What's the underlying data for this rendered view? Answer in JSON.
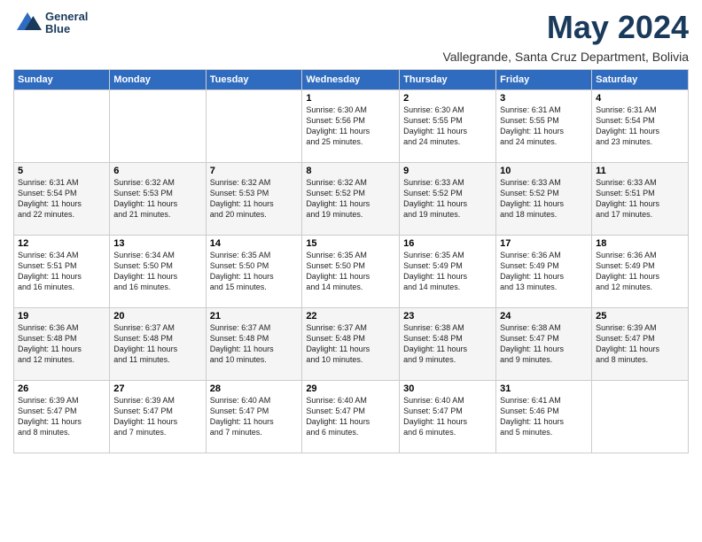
{
  "header": {
    "logo_line1": "General",
    "logo_line2": "Blue",
    "month_title": "May 2024",
    "subtitle": "Vallegrande, Santa Cruz Department, Bolivia"
  },
  "weekdays": [
    "Sunday",
    "Monday",
    "Tuesday",
    "Wednesday",
    "Thursday",
    "Friday",
    "Saturday"
  ],
  "weeks": [
    [
      {
        "day": "",
        "info": ""
      },
      {
        "day": "",
        "info": ""
      },
      {
        "day": "",
        "info": ""
      },
      {
        "day": "1",
        "info": "Sunrise: 6:30 AM\nSunset: 5:56 PM\nDaylight: 11 hours\nand 25 minutes."
      },
      {
        "day": "2",
        "info": "Sunrise: 6:30 AM\nSunset: 5:55 PM\nDaylight: 11 hours\nand 24 minutes."
      },
      {
        "day": "3",
        "info": "Sunrise: 6:31 AM\nSunset: 5:55 PM\nDaylight: 11 hours\nand 24 minutes."
      },
      {
        "day": "4",
        "info": "Sunrise: 6:31 AM\nSunset: 5:54 PM\nDaylight: 11 hours\nand 23 minutes."
      }
    ],
    [
      {
        "day": "5",
        "info": "Sunrise: 6:31 AM\nSunset: 5:54 PM\nDaylight: 11 hours\nand 22 minutes."
      },
      {
        "day": "6",
        "info": "Sunrise: 6:32 AM\nSunset: 5:53 PM\nDaylight: 11 hours\nand 21 minutes."
      },
      {
        "day": "7",
        "info": "Sunrise: 6:32 AM\nSunset: 5:53 PM\nDaylight: 11 hours\nand 20 minutes."
      },
      {
        "day": "8",
        "info": "Sunrise: 6:32 AM\nSunset: 5:52 PM\nDaylight: 11 hours\nand 19 minutes."
      },
      {
        "day": "9",
        "info": "Sunrise: 6:33 AM\nSunset: 5:52 PM\nDaylight: 11 hours\nand 19 minutes."
      },
      {
        "day": "10",
        "info": "Sunrise: 6:33 AM\nSunset: 5:52 PM\nDaylight: 11 hours\nand 18 minutes."
      },
      {
        "day": "11",
        "info": "Sunrise: 6:33 AM\nSunset: 5:51 PM\nDaylight: 11 hours\nand 17 minutes."
      }
    ],
    [
      {
        "day": "12",
        "info": "Sunrise: 6:34 AM\nSunset: 5:51 PM\nDaylight: 11 hours\nand 16 minutes."
      },
      {
        "day": "13",
        "info": "Sunrise: 6:34 AM\nSunset: 5:50 PM\nDaylight: 11 hours\nand 16 minutes."
      },
      {
        "day": "14",
        "info": "Sunrise: 6:35 AM\nSunset: 5:50 PM\nDaylight: 11 hours\nand 15 minutes."
      },
      {
        "day": "15",
        "info": "Sunrise: 6:35 AM\nSunset: 5:50 PM\nDaylight: 11 hours\nand 14 minutes."
      },
      {
        "day": "16",
        "info": "Sunrise: 6:35 AM\nSunset: 5:49 PM\nDaylight: 11 hours\nand 14 minutes."
      },
      {
        "day": "17",
        "info": "Sunrise: 6:36 AM\nSunset: 5:49 PM\nDaylight: 11 hours\nand 13 minutes."
      },
      {
        "day": "18",
        "info": "Sunrise: 6:36 AM\nSunset: 5:49 PM\nDaylight: 11 hours\nand 12 minutes."
      }
    ],
    [
      {
        "day": "19",
        "info": "Sunrise: 6:36 AM\nSunset: 5:48 PM\nDaylight: 11 hours\nand 12 minutes."
      },
      {
        "day": "20",
        "info": "Sunrise: 6:37 AM\nSunset: 5:48 PM\nDaylight: 11 hours\nand 11 minutes."
      },
      {
        "day": "21",
        "info": "Sunrise: 6:37 AM\nSunset: 5:48 PM\nDaylight: 11 hours\nand 10 minutes."
      },
      {
        "day": "22",
        "info": "Sunrise: 6:37 AM\nSunset: 5:48 PM\nDaylight: 11 hours\nand 10 minutes."
      },
      {
        "day": "23",
        "info": "Sunrise: 6:38 AM\nSunset: 5:48 PM\nDaylight: 11 hours\nand 9 minutes."
      },
      {
        "day": "24",
        "info": "Sunrise: 6:38 AM\nSunset: 5:47 PM\nDaylight: 11 hours\nand 9 minutes."
      },
      {
        "day": "25",
        "info": "Sunrise: 6:39 AM\nSunset: 5:47 PM\nDaylight: 11 hours\nand 8 minutes."
      }
    ],
    [
      {
        "day": "26",
        "info": "Sunrise: 6:39 AM\nSunset: 5:47 PM\nDaylight: 11 hours\nand 8 minutes."
      },
      {
        "day": "27",
        "info": "Sunrise: 6:39 AM\nSunset: 5:47 PM\nDaylight: 11 hours\nand 7 minutes."
      },
      {
        "day": "28",
        "info": "Sunrise: 6:40 AM\nSunset: 5:47 PM\nDaylight: 11 hours\nand 7 minutes."
      },
      {
        "day": "29",
        "info": "Sunrise: 6:40 AM\nSunset: 5:47 PM\nDaylight: 11 hours\nand 6 minutes."
      },
      {
        "day": "30",
        "info": "Sunrise: 6:40 AM\nSunset: 5:47 PM\nDaylight: 11 hours\nand 6 minutes."
      },
      {
        "day": "31",
        "info": "Sunrise: 6:41 AM\nSunset: 5:46 PM\nDaylight: 11 hours\nand 5 minutes."
      },
      {
        "day": "",
        "info": ""
      }
    ]
  ]
}
